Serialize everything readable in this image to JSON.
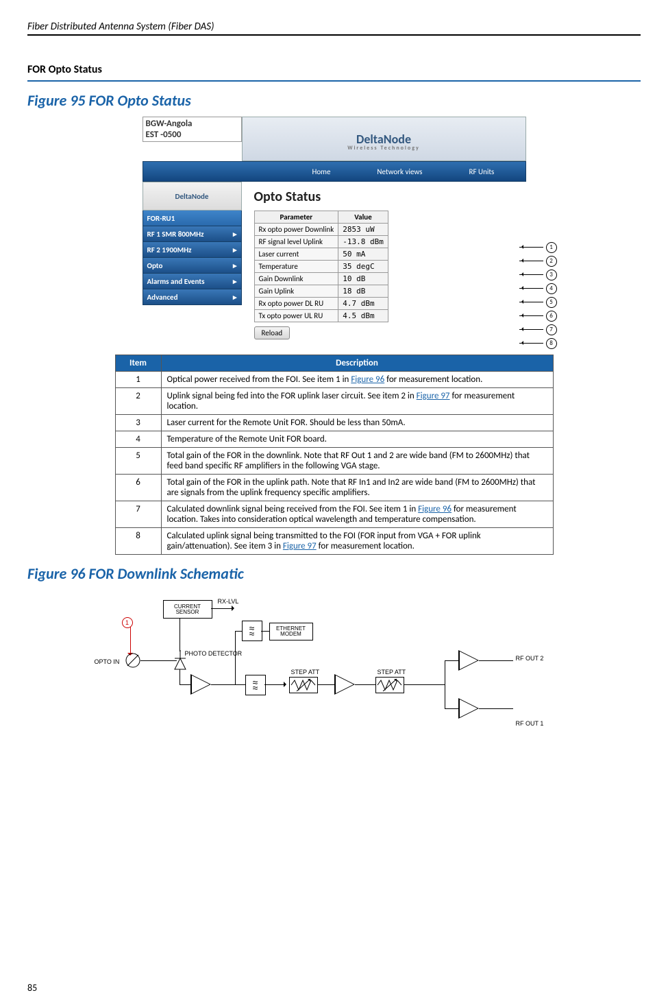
{
  "page_header": "Fiber Distributed Antenna System (Fiber DAS)",
  "page_number": "85",
  "section_title": "FOR Opto Status",
  "figure95_caption": "Figure 95    FOR Opto Status",
  "figure96_caption": "Figure 96    FOR Downlink Schematic",
  "brand": "DeltaNode",
  "brand_sub": "Wireless   Technology",
  "node_line1": "BGW-Angola",
  "node_line2": "EST -0500",
  "menu": {
    "home": "Home",
    "network": "Network views",
    "rf": "RF Units"
  },
  "sidebar": {
    "items": [
      "FOR-RU1",
      "RF 1 SMR 800MHz",
      "RF 2 1900MHz",
      "Opto",
      "Alarms and Events",
      "Advanced"
    ]
  },
  "opto_title": "Opto Status",
  "opto_headers": {
    "p": "Parameter",
    "v": "Value"
  },
  "opto_rows": [
    {
      "p": "Rx opto power Downlink",
      "v": "2853 uW"
    },
    {
      "p": "RF signal level Uplink",
      "v": "-13.8 dBm"
    },
    {
      "p": "Laser current",
      "v": "50 mA"
    },
    {
      "p": "Temperature",
      "v": "35 degC"
    },
    {
      "p": "Gain Downlink",
      "v": "10 dB"
    },
    {
      "p": "Gain Uplink",
      "v": "18 dB"
    },
    {
      "p": "Rx opto power DL RU",
      "v": "4.7 dBm"
    },
    {
      "p": "Tx opto power UL RU",
      "v": "4.5 dBm"
    }
  ],
  "reload": "Reload",
  "callouts": [
    "1",
    "2",
    "3",
    "4",
    "5",
    "6",
    "7",
    "8"
  ],
  "desc_headers": {
    "item": "Item",
    "desc": "Description"
  },
  "desc_rows": [
    {
      "i": "1",
      "d_pre": "Optical power received from the FOI. See item 1 in ",
      "ref": "Figure 96",
      "d_post": " for measurement location."
    },
    {
      "i": "2",
      "d_pre": "Uplink signal being fed into the FOR uplink laser circuit. See item 2 in ",
      "ref": "Figure 97",
      "d_post": " for measurement location."
    },
    {
      "i": "3",
      "d_pre": "Laser current for the Remote Unit FOR. Should be less than 50mA.",
      "ref": "",
      "d_post": ""
    },
    {
      "i": "4",
      "d_pre": "Temperature of the Remote Unit FOR board.",
      "ref": "",
      "d_post": ""
    },
    {
      "i": "5",
      "d_pre": "Total gain of the FOR in the downlink. Note that RF Out 1 and 2 are wide band (FM to 2600MHz) that feed band specific RF amplifiers in the following VGA stage.",
      "ref": "",
      "d_post": ""
    },
    {
      "i": "6",
      "d_pre": "Total gain of the FOR in the uplink path. Note that RF In1 and In2 are wide band (FM to 2600MHz) that are signals from the uplink frequency specific amplifiers.",
      "ref": "",
      "d_post": ""
    },
    {
      "i": "7",
      "d_pre": "Calculated downlink signal being received from the FOI.   See item 1 in ",
      "ref": "Figure 96",
      "d_post": " for measurement location. Takes into consideration optical wavelength and temperature compensation."
    },
    {
      "i": "8",
      "d_pre": "Calculated uplink signal being transmitted to the FOI (FOR input from VGA + FOR uplink gain/attenuation). See item 3 in ",
      "ref": "Figure 97",
      "d_post": " for measurement location."
    }
  ],
  "schematic": {
    "opto_in": "OPTO IN",
    "current_sensor": "CURRENT SENSOR",
    "rx_lvl": "RX-LVL",
    "photo_detector": "PHOTO DETECTOR",
    "ethernet_modem": "ETHERNET MODEM",
    "step_att": "STEP ATT",
    "rf_out1": "RF OUT 1",
    "rf_out2": "RF OUT 2",
    "callout1": "1"
  }
}
